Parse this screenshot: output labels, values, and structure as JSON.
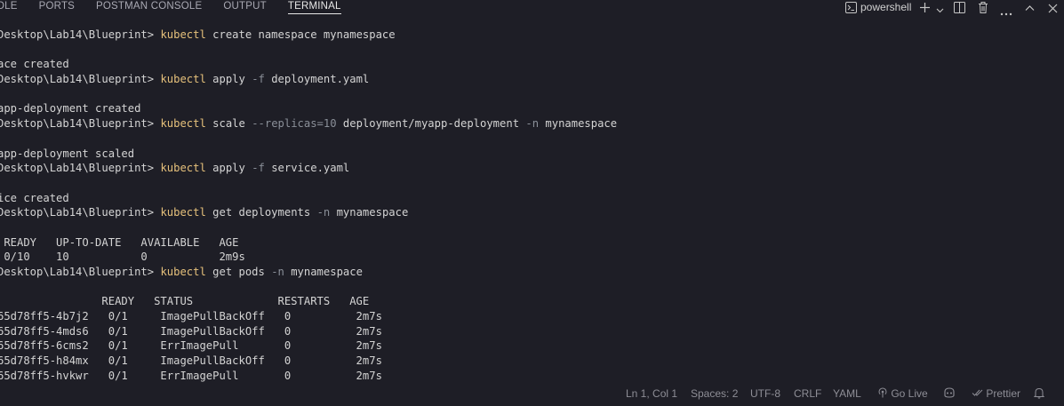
{
  "tabs": [
    {
      "label": "OLE",
      "active": false
    },
    {
      "label": "PORTS",
      "active": false
    },
    {
      "label": "POSTMAN CONSOLE",
      "active": false
    },
    {
      "label": "OUTPUT",
      "active": false
    },
    {
      "label": "TERMINAL",
      "active": true
    }
  ],
  "toolbar": {
    "terminal_name": "powershell",
    "icons": [
      "terminal-icon",
      "plus-icon",
      "chevron-down-icon",
      "split-icon",
      "trash-icon",
      "more-icon",
      "chevron-up-icon",
      "close-icon"
    ]
  },
  "terminal_lines": [
    [
      {
        "t": "Desktop\\Lab14\\Blueprint> ",
        "c": "plain"
      },
      {
        "t": "kubectl",
        "c": "cmd"
      },
      {
        "t": " create namespace mynamespace",
        "c": "plain"
      }
    ],
    [],
    [
      {
        "t": "ace created",
        "c": "plain"
      }
    ],
    [
      {
        "t": "Desktop\\Lab14\\Blueprint> ",
        "c": "plain"
      },
      {
        "t": "kubectl",
        "c": "cmd"
      },
      {
        "t": " apply ",
        "c": "plain"
      },
      {
        "t": "-f",
        "c": "param"
      },
      {
        "t": " deployment.yaml",
        "c": "plain"
      }
    ],
    [],
    [
      {
        "t": "app-deployment created",
        "c": "plain"
      }
    ],
    [
      {
        "t": "Desktop\\Lab14\\Blueprint> ",
        "c": "plain"
      },
      {
        "t": "kubectl",
        "c": "cmd"
      },
      {
        "t": " scale ",
        "c": "plain"
      },
      {
        "t": "--replicas=10",
        "c": "param"
      },
      {
        "t": " deployment/myapp-deployment ",
        "c": "plain"
      },
      {
        "t": "-n",
        "c": "param"
      },
      {
        "t": " mynamespace",
        "c": "plain"
      }
    ],
    [],
    [
      {
        "t": "app-deployment scaled",
        "c": "plain"
      }
    ],
    [
      {
        "t": "Desktop\\Lab14\\Blueprint> ",
        "c": "plain"
      },
      {
        "t": "kubectl",
        "c": "cmd"
      },
      {
        "t": " apply ",
        "c": "plain"
      },
      {
        "t": "-f",
        "c": "param"
      },
      {
        "t": " service.yaml",
        "c": "plain"
      }
    ],
    [],
    [
      {
        "t": "ice created",
        "c": "plain"
      }
    ],
    [
      {
        "t": "Desktop\\Lab14\\Blueprint> ",
        "c": "plain"
      },
      {
        "t": "kubectl",
        "c": "cmd"
      },
      {
        "t": " get deployments ",
        "c": "plain"
      },
      {
        "t": "-n",
        "c": "param"
      },
      {
        "t": " mynamespace",
        "c": "plain"
      }
    ],
    [],
    [
      {
        "t": " READY   UP-TO-DATE   AVAILABLE   AGE",
        "c": "plain"
      }
    ],
    [
      {
        "t": " 0/10    10           0           2m9s",
        "c": "plain"
      }
    ],
    [
      {
        "t": "Desktop\\Lab14\\Blueprint> ",
        "c": "plain"
      },
      {
        "t": "kubectl",
        "c": "cmd"
      },
      {
        "t": " get pods ",
        "c": "plain"
      },
      {
        "t": "-n",
        "c": "param"
      },
      {
        "t": " mynamespace",
        "c": "plain"
      }
    ],
    [],
    [
      {
        "t": "                READY   STATUS             RESTARTS   AGE",
        "c": "plain"
      }
    ],
    [
      {
        "t": "65d78ff5-4b7j2   0/1     ImagePullBackOff   0          2m7s",
        "c": "plain"
      }
    ],
    [
      {
        "t": "65d78ff5-4mds6   0/1     ImagePullBackOff   0          2m7s",
        "c": "plain"
      }
    ],
    [
      {
        "t": "65d78ff5-6cms2   0/1     ErrImagePull       0          2m7s",
        "c": "plain"
      }
    ],
    [
      {
        "t": "65d78ff5-h84mx   0/1     ImagePullBackOff   0          2m7s",
        "c": "plain"
      }
    ],
    [
      {
        "t": "65d78ff5-hvkwr   0/1     ErrImagePull       0          2m7s",
        "c": "plain"
      }
    ]
  ],
  "statusbar": {
    "position": "Ln 1, Col 1",
    "spaces": "Spaces: 2",
    "encoding": "UTF-8",
    "eol": "CRLF",
    "language": "YAML",
    "go_live": "Go Live",
    "prettier": "Prettier"
  },
  "colors": {
    "background": "#1e1e26",
    "command": "#e5c07b",
    "parameter": "#8a8f98",
    "text": "#d4d4d4"
  }
}
